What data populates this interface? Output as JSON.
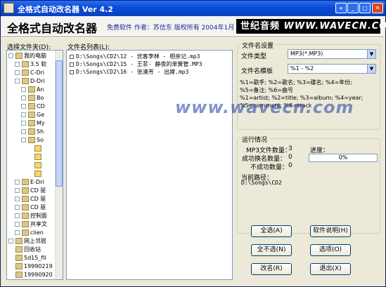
{
  "window": {
    "title": "全格式自动改名器 Ver 4.2"
  },
  "header": {
    "app_name": "全格式自动改名器",
    "subtitle": "免费软件 作者：苏信东 版权所有 2004年1月",
    "banner_cn": "世纪音频",
    "banner_url": "WWW.WAVECN.COM"
  },
  "left": {
    "folder_label": "选择文件夹(D):",
    "tree": [
      {
        "label": "我的电脑",
        "indent": 0,
        "exp": "-"
      },
      {
        "label": "3.5 软",
        "indent": 1,
        "exp": "+"
      },
      {
        "label": "C-Dri",
        "indent": 1,
        "exp": "+"
      },
      {
        "label": "D-Dri",
        "indent": 1,
        "exp": "-"
      },
      {
        "label": "An",
        "indent": 2,
        "exp": "+"
      },
      {
        "label": "Bo",
        "indent": 2,
        "exp": "+"
      },
      {
        "label": "CD",
        "indent": 2,
        "exp": "+"
      },
      {
        "label": "Ge",
        "indent": 2,
        "exp": "+"
      },
      {
        "label": "My",
        "indent": 2,
        "exp": "+"
      },
      {
        "label": "Sh",
        "indent": 2,
        "exp": "+"
      },
      {
        "label": "So",
        "indent": 2,
        "exp": "-"
      },
      {
        "label": "",
        "indent": 3,
        "exp": ""
      },
      {
        "label": "",
        "indent": 3,
        "exp": ""
      },
      {
        "label": "",
        "indent": 3,
        "exp": ""
      },
      {
        "label": "",
        "indent": 3,
        "exp": ""
      },
      {
        "label": "E-Dri",
        "indent": 1,
        "exp": "+"
      },
      {
        "label": "CD 驱",
        "indent": 1,
        "exp": "+"
      },
      {
        "label": "CD 驱",
        "indent": 1,
        "exp": "+"
      },
      {
        "label": "CD 驱",
        "indent": 1,
        "exp": "+"
      },
      {
        "label": "控制面",
        "indent": 1,
        "exp": "+"
      },
      {
        "label": "共享文",
        "indent": 1,
        "exp": "+"
      },
      {
        "label": "clien",
        "indent": 1,
        "exp": "+"
      },
      {
        "label": "网上邻居",
        "indent": 0,
        "exp": "+"
      },
      {
        "label": "回收站",
        "indent": 0,
        "exp": ""
      },
      {
        "label": "5d15_fil",
        "indent": 0,
        "exp": ""
      },
      {
        "label": "19990219",
        "indent": 0,
        "exp": ""
      },
      {
        "label": "19990920",
        "indent": 0,
        "exp": ""
      }
    ]
  },
  "middle": {
    "list_label": "文件名列表(L):",
    "files": [
      "D:\\Songs\\CD2\\12 - 优客李林 - 相亲记.mp3",
      "D:\\Songs\\CD2\\15 - 王菲- 静夜的单簧管.MP3",
      "D:\\Songs\\CD2\\16 - 张清芳 - 出嫁.mp3"
    ]
  },
  "settings": {
    "group": "文件名设置",
    "type_label": "文件类型",
    "type_value": "MP3(*.MP3)",
    "template_label": "文件名模板",
    "template_value": "%1 - %2",
    "help": [
      "%1=歌手; %2=歌名; %3=碟名; %4=年份;",
      "%5=备注; %6=曲号",
      "%1=artist; %2=title; %3=album; %4=year;",
      "%5=comment; %6=track"
    ]
  },
  "status": {
    "group": "运行情况",
    "mp3_count_label": "MP3文件数量：",
    "mp3_count": "3",
    "ok_label": "成功换名数量：",
    "ok": "0",
    "fail_label": "不成功数量：",
    "fail": "0",
    "progress_label": "进度：",
    "progress": "0%",
    "path_label": "当前路径：",
    "path": "D:\\Songs\\CD2"
  },
  "buttons": {
    "select_all": "全选(A)",
    "select_none": "全不选(N)",
    "rename": "改名(R)",
    "help": "软件说明(H)",
    "options": "选项(O)",
    "exit": "退出(X)"
  },
  "watermark": "www.wavecn.com"
}
